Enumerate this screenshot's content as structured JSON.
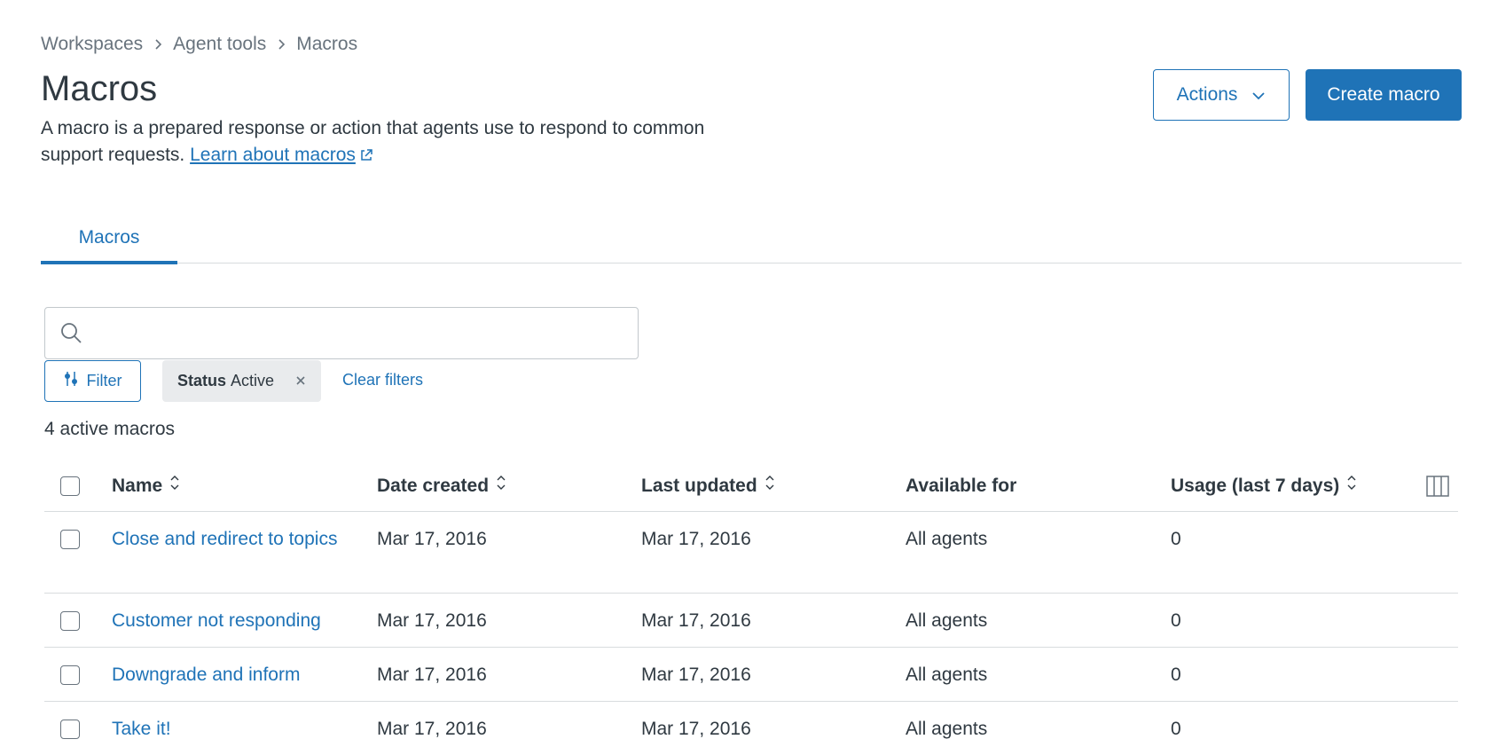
{
  "breadcrumb": {
    "items": [
      "Workspaces",
      "Agent tools",
      "Macros"
    ]
  },
  "page": {
    "title": "Macros",
    "description": "A macro is a prepared response or action that agents use to respond to common support requests.",
    "learn_link": "Learn about macros"
  },
  "header_actions": {
    "actions_label": "Actions",
    "create_label": "Create macro"
  },
  "tabs": [
    {
      "label": "Macros",
      "active": true
    }
  ],
  "search": {
    "value": "",
    "placeholder": ""
  },
  "filters": {
    "filter_label": "Filter",
    "chip_key": "Status",
    "chip_value": "Active",
    "clear_label": "Clear filters"
  },
  "count_text": "4 active macros",
  "table": {
    "columns": [
      "Name",
      "Date created",
      "Last updated",
      "Available for",
      "Usage (last 7 days)"
    ],
    "rows": [
      {
        "name": "Close and redirect to topics",
        "created": "Mar 17, 2016",
        "updated": "Mar 17, 2016",
        "available": "All agents",
        "usage": "0"
      },
      {
        "name": "Customer not responding",
        "created": "Mar 17, 2016",
        "updated": "Mar 17, 2016",
        "available": "All agents",
        "usage": "0"
      },
      {
        "name": "Downgrade and inform",
        "created": "Mar 17, 2016",
        "updated": "Mar 17, 2016",
        "available": "All agents",
        "usage": "0"
      },
      {
        "name": "Take it!",
        "created": "Mar 17, 2016",
        "updated": "Mar 17, 2016",
        "available": "All agents",
        "usage": "0"
      }
    ]
  },
  "colors": {
    "accent": "#1f73b7",
    "text": "#2f3941",
    "muted": "#68737d",
    "border": "#d8dcde",
    "chip_bg": "#e9ebed"
  },
  "icons": [
    "chevron-right-icon",
    "external-link-icon",
    "chevron-down-icon",
    "search-icon",
    "filter-sliders-icon",
    "close-icon",
    "sort-icon",
    "columns-icon"
  ]
}
